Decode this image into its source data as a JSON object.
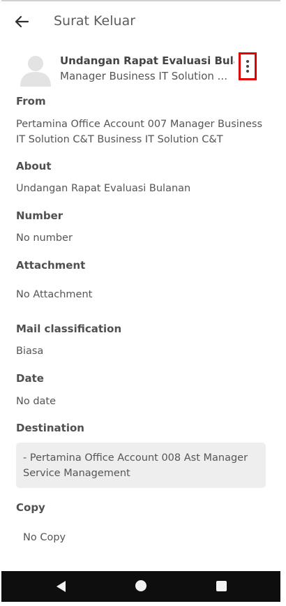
{
  "header": {
    "title": "Surat Keluar",
    "back_icon": "arrow-left-icon"
  },
  "mail": {
    "subject": "Undangan Rapat Evaluasi Bulanan",
    "sender": "Manager Business IT Solution ...",
    "avatar_icon": "person-avatar-icon",
    "menu_icon": "more-vertical-icon"
  },
  "fields": {
    "from_label": "From",
    "from_value": "Pertamina Office Account 007 Manager Business IT Solution C&T Business IT Solution C&T",
    "about_label": "About",
    "about_value": "Undangan Rapat Evaluasi Bulanan",
    "number_label": "Number",
    "number_value": "No number",
    "attachment_label": "Attachment",
    "attachment_value": "No Attachment",
    "classification_label": "Mail classification",
    "classification_value": "Biasa",
    "date_label": "Date",
    "date_value": "No date",
    "destination_label": "Destination",
    "destination_value": "- Pertamina Office Account 008 Ast Manager Service Management",
    "copy_label": "Copy",
    "copy_value": "No Copy"
  },
  "navbar": {
    "back_icon": "nav-back-triangle-icon",
    "home_icon": "nav-home-circle-icon",
    "recent_icon": "nav-recent-square-icon"
  },
  "colors": {
    "highlight_box": "#e00000",
    "destination_bg": "#eeeeee",
    "navbar_bg": "#0e0e0e"
  }
}
